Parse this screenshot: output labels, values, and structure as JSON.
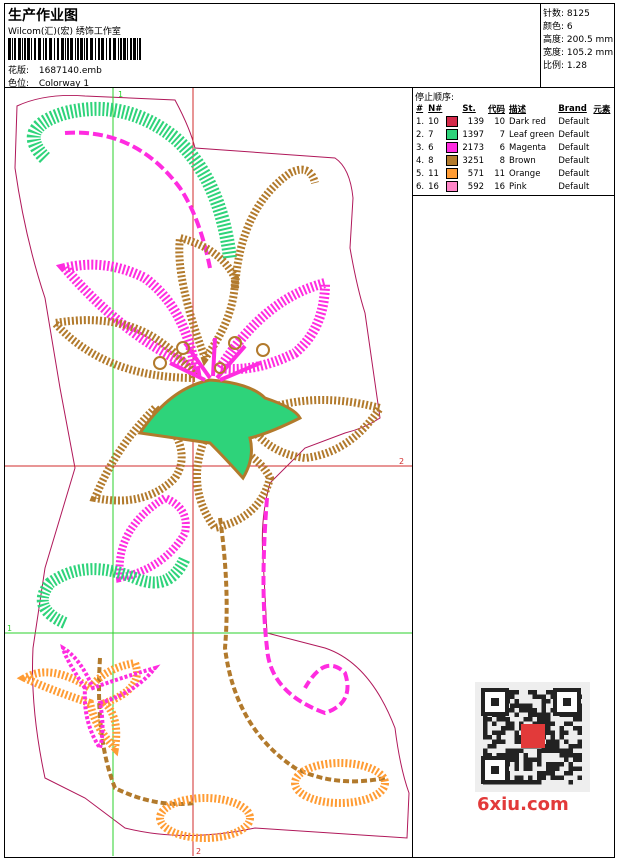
{
  "header": {
    "title": "生产作业图",
    "company": "Wilcom(汇)(宏) 绣饰工作室",
    "design_label": "花版:",
    "design_value": "1687140.emb",
    "colorway_label": "色位:",
    "colorway_value": "Colorway 1"
  },
  "specs": [
    {
      "label": "针数:",
      "value": "8125"
    },
    {
      "label": "颜色:",
      "value": "6"
    },
    {
      "label": "高度:",
      "value": "200.5 mm"
    },
    {
      "label": "宽度:",
      "value": "105.2 mm"
    },
    {
      "label": "比例:",
      "value": "1.28"
    }
  ],
  "sequence": {
    "title": "停止顺序:",
    "columns": [
      "#",
      "N#",
      "St.",
      "代码",
      "描述",
      "Brand",
      "元素"
    ],
    "rows": [
      {
        "idx": "1.",
        "n": "10",
        "color": "#d42a4a",
        "st": "139",
        "code": "10",
        "desc": "Dark red",
        "brand": "Default"
      },
      {
        "idx": "2.",
        "n": "7",
        "color": "#2ed37a",
        "st": "1397",
        "code": "7",
        "desc": "Leaf green",
        "brand": "Default"
      },
      {
        "idx": "3.",
        "n": "6",
        "color": "#ff2ce0",
        "st": "2173",
        "code": "6",
        "desc": "Magenta",
        "brand": "Default"
      },
      {
        "idx": "4.",
        "n": "8",
        "color": "#b27a2c",
        "st": "3251",
        "code": "8",
        "desc": "Brown",
        "brand": "Default"
      },
      {
        "idx": "5.",
        "n": "11",
        "color": "#ff9c34",
        "st": "571",
        "code": "11",
        "desc": "Orange",
        "brand": "Default"
      },
      {
        "idx": "6.",
        "n": "16",
        "color": "#ff86c8",
        "st": "592",
        "code": "16",
        "desc": "Pink",
        "brand": "Default"
      }
    ]
  },
  "axes": {
    "v1": "1",
    "v2": "2",
    "h1": "1",
    "h2": "2"
  },
  "watermark": "6xiu.com"
}
